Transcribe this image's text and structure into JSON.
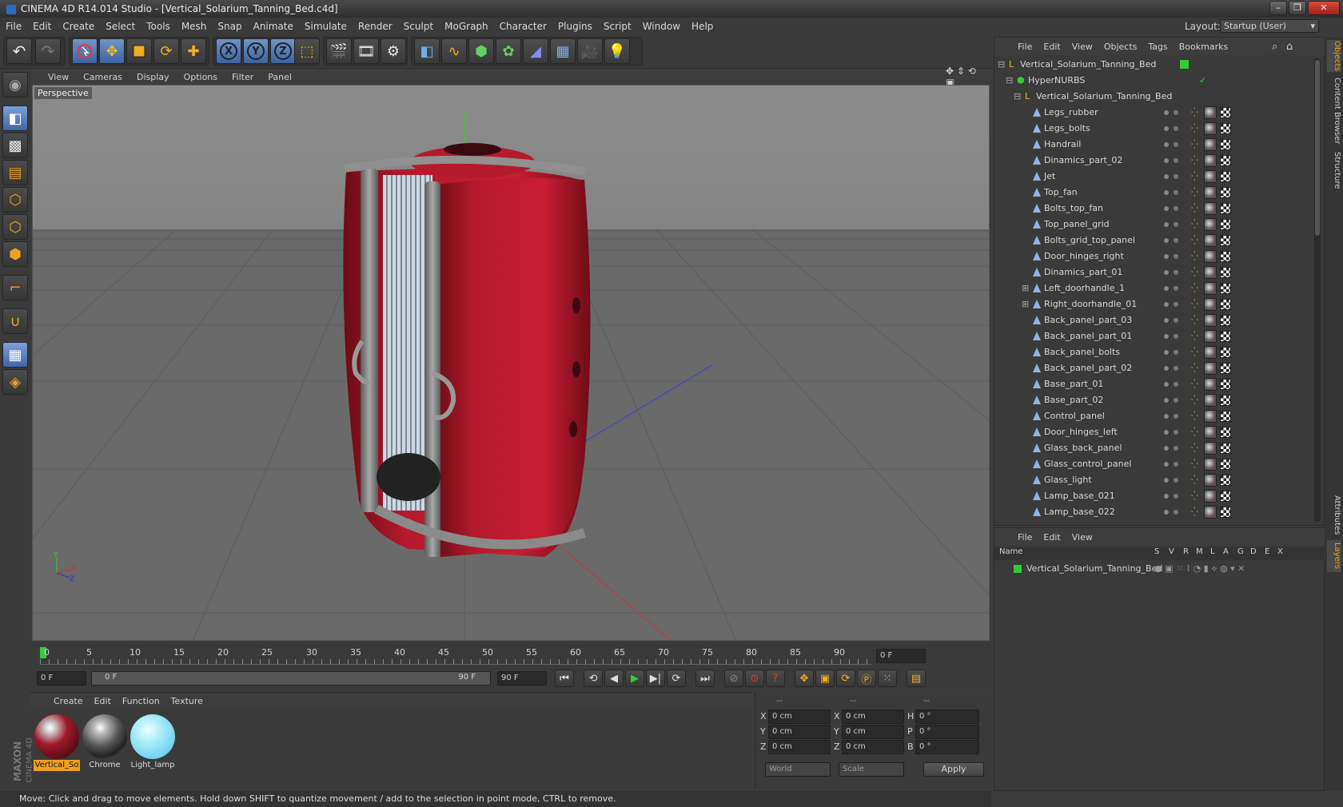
{
  "window": {
    "title": "CINEMA 4D R14.014 Studio - [Vertical_Solarium_Tanning_Bed.c4d]",
    "controls": [
      "–",
      "❐",
      "✕"
    ]
  },
  "menu": [
    "File",
    "Edit",
    "Create",
    "Select",
    "Tools",
    "Mesh",
    "Snap",
    "Animate",
    "Simulate",
    "Render",
    "Sculpt",
    "MoGraph",
    "Character",
    "Plugins",
    "Script",
    "Window",
    "Help"
  ],
  "layout": {
    "label": "Layout:",
    "value": "Startup (User)"
  },
  "toolbar": {
    "undo_icon": "undo-icon",
    "redo_icon": "redo-icon",
    "axis_x": "X",
    "axis_y": "Y",
    "axis_z": "Z"
  },
  "viewport": {
    "menu": [
      "View",
      "Cameras",
      "Display",
      "Options",
      "Filter",
      "Panel"
    ],
    "label": "Perspective",
    "axis": {
      "x": "X",
      "y": "Y",
      "z": "Z"
    }
  },
  "timeline": {
    "ticks": [
      "0",
      "5",
      "10",
      "15",
      "20",
      "25",
      "30",
      "35",
      "40",
      "45",
      "50",
      "55",
      "60",
      "65",
      "70",
      "75",
      "80",
      "85",
      "90"
    ],
    "current_frame": "0 F",
    "start": "0 F",
    "range_start": "0 F",
    "range_end": "90 F",
    "end": "90 F"
  },
  "materials": {
    "menu": [
      "Create",
      "Edit",
      "Function",
      "Texture"
    ],
    "items": [
      {
        "name": "Vertical_So",
        "selected": true
      },
      {
        "name": "Chrome",
        "selected": false
      },
      {
        "name": "Light_lamp",
        "selected": false
      }
    ]
  },
  "coords": {
    "headers": [
      "--",
      "--",
      "--"
    ],
    "rows": [
      {
        "a": "X",
        "av": "0 cm",
        "b": "X",
        "bv": "0 cm",
        "c": "H",
        "cv": "0 °"
      },
      {
        "a": "Y",
        "av": "0 cm",
        "b": "Y",
        "bv": "0 cm",
        "c": "P",
        "cv": "0 °"
      },
      {
        "a": "Z",
        "av": "0 cm",
        "b": "Z",
        "bv": "0 cm",
        "c": "B",
        "cv": "0 °"
      }
    ],
    "mode1": "World",
    "mode2": "Scale",
    "apply": "Apply"
  },
  "logo": {
    "line1": "MAXON",
    "line2": "CINEMA 4D"
  },
  "status": "Move: Click and drag to move elements. Hold down SHIFT to quantize movement / add to the selection in point mode, CTRL to remove.",
  "objects": {
    "menu": [
      "File",
      "Edit",
      "View",
      "Objects",
      "Tags",
      "Bookmarks"
    ],
    "root": "Vertical_Solarium_Tanning_Bed",
    "hypernurbs": "HyperNURBS",
    "group": "Vertical_Solarium_Tanning_Bed",
    "items": [
      "Legs_rubber",
      "Legs_bolts",
      "Handrail",
      "Dinamics_part_02",
      "Jet",
      "Top_fan",
      "Bolts_top_fan",
      "Top_panel_grid",
      "Bolts_grid_top_panel",
      "Door_hinges_right",
      "Dinamics_part_01",
      "Left_doorhandle_1",
      "Right_doorhandle_01",
      "Back_panel_part_03",
      "Back_panel_part_01",
      "Back_panel_bolts",
      "Back_panel_part_02",
      "Base_part_01",
      "Base_part_02",
      "Control_panel",
      "Door_hinges_left",
      "Glass_back_panel",
      "Glass_control_panel",
      "Glass_light",
      "Lamp_base_021",
      "Lamp_base_022"
    ]
  },
  "layers": {
    "menu": [
      "File",
      "Edit",
      "View"
    ],
    "columns": [
      "Name",
      "S",
      "V",
      "R",
      "M",
      "L",
      "A",
      "G",
      "D",
      "E",
      "X"
    ],
    "rows": [
      "Vertical_Solarium_Tanning_Bed"
    ]
  },
  "side_tabs": [
    "Objects",
    "Content Browser",
    "Structure",
    "Attributes",
    "Layers"
  ],
  "colors": {
    "accent": "#f0a020",
    "selection": "#f0a020",
    "viewport_bg": "#6e6e6e",
    "bed_red": "#b0182a"
  }
}
